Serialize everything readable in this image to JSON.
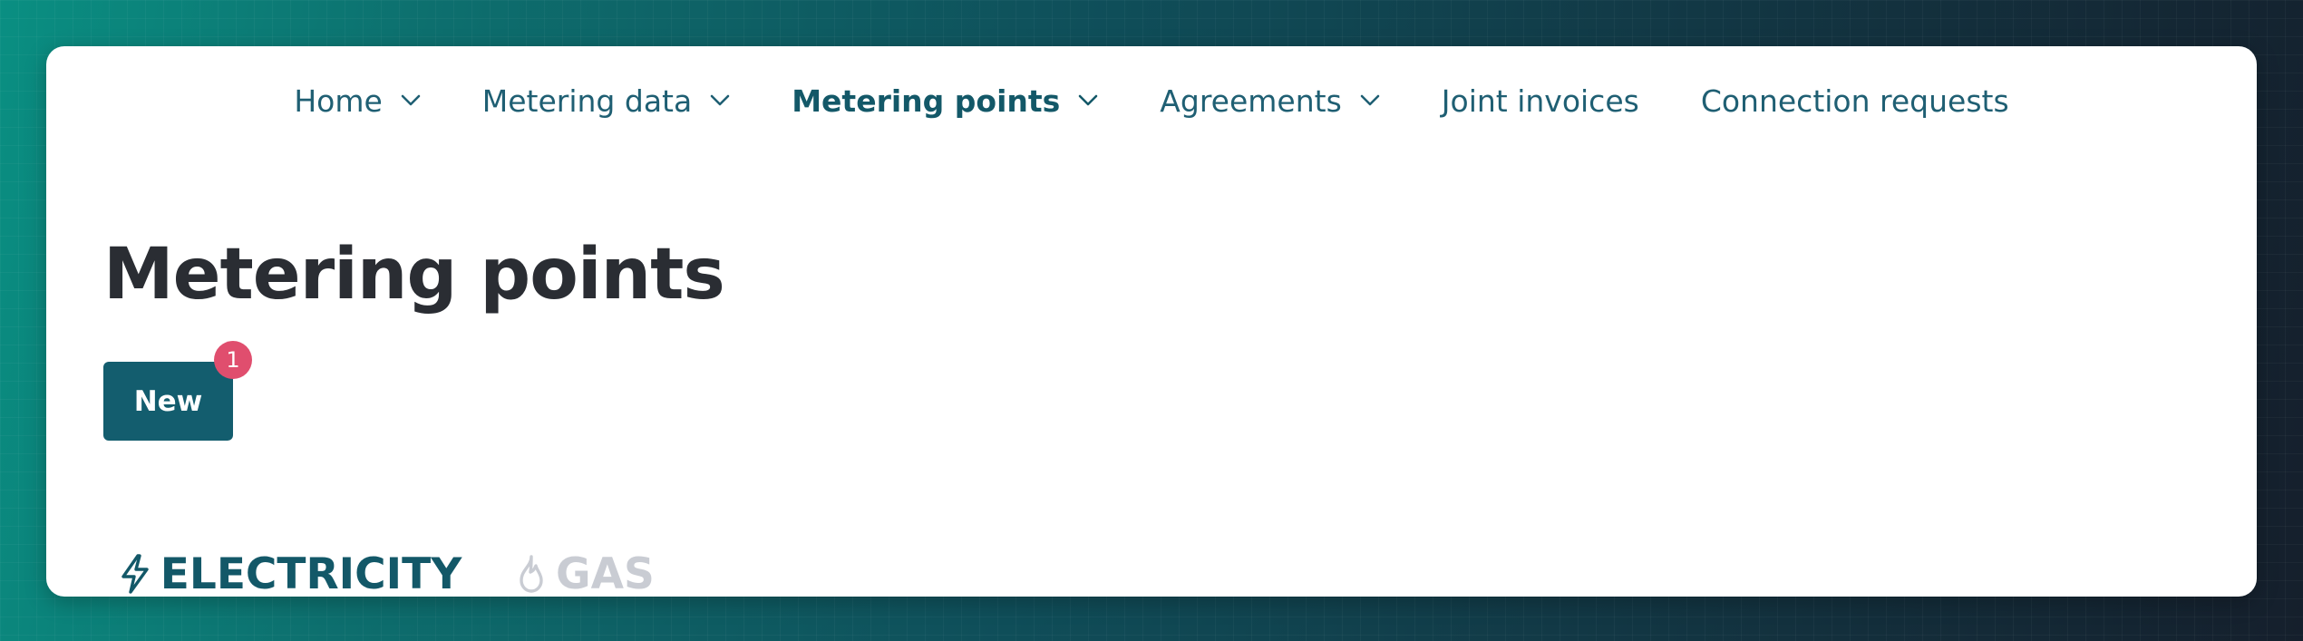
{
  "nav": {
    "items": [
      {
        "label": "Home",
        "has_dropdown": true,
        "active": false
      },
      {
        "label": "Metering data",
        "has_dropdown": true,
        "active": false
      },
      {
        "label": "Metering points",
        "has_dropdown": true,
        "active": true
      },
      {
        "label": "Agreements",
        "has_dropdown": true,
        "active": false
      },
      {
        "label": "Joint invoices",
        "has_dropdown": false,
        "active": false
      },
      {
        "label": "Connection requests",
        "has_dropdown": false,
        "active": false
      }
    ]
  },
  "page": {
    "title": "Metering points"
  },
  "actions": {
    "new_label": "New",
    "new_badge": "1"
  },
  "tabs": [
    {
      "label": "ELECTRICITY",
      "icon": "lightning-bolt-icon",
      "active": true
    },
    {
      "label": "GAS",
      "icon": "flame-icon",
      "active": false
    }
  ],
  "colors": {
    "primary": "#135d6e",
    "nav_text": "#1f5f73",
    "badge": "#e04e6e",
    "inactive_tab": "#c9ccd3",
    "title": "#2a2d33"
  }
}
